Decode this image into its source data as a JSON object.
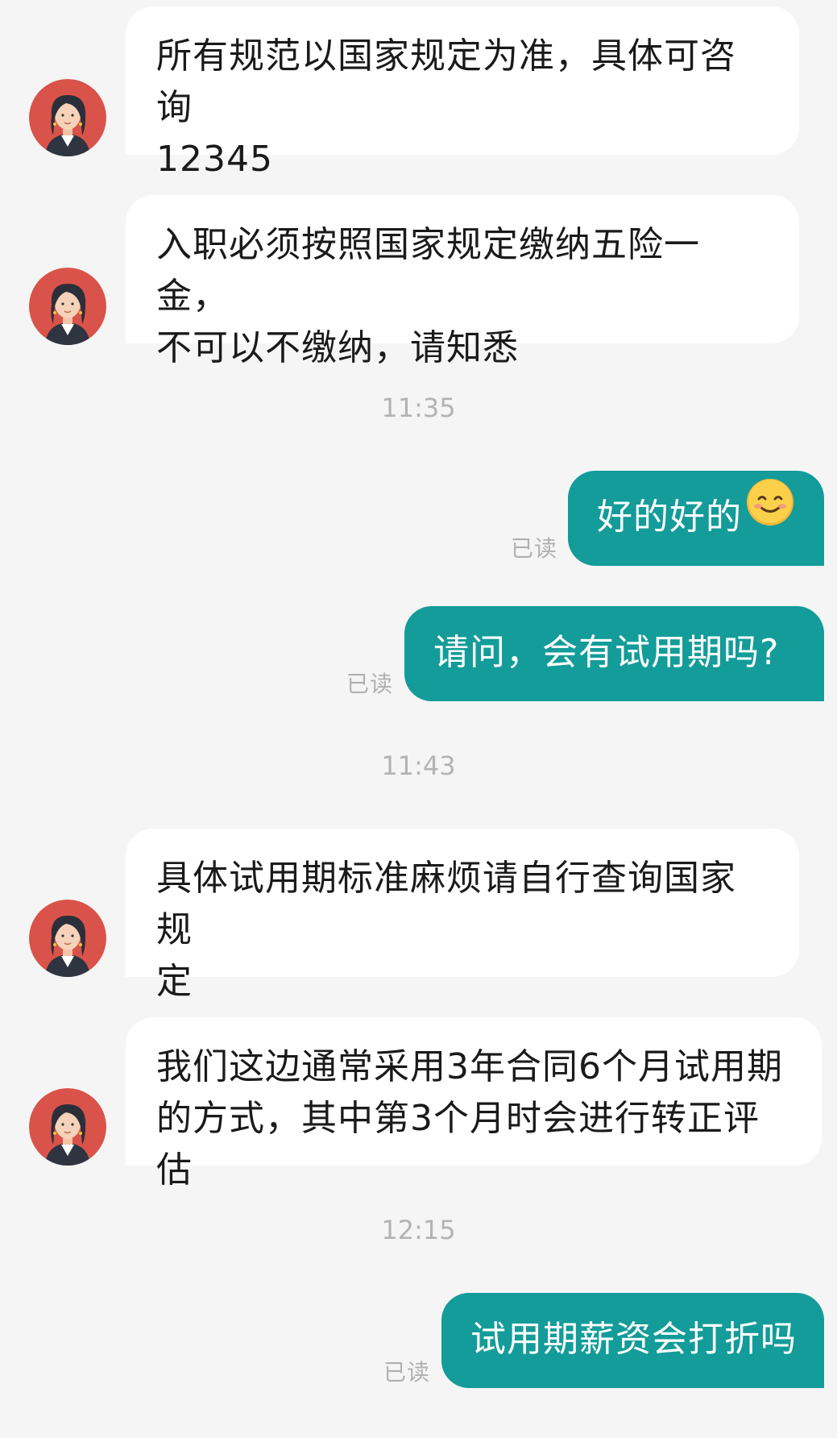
{
  "conversation": {
    "messages": [
      {
        "from": "other",
        "text": "所有规范以国家规定为准，具体可咨询12345",
        "line1": "所有规范以国家规定为准，具体可咨询",
        "line2": "12345"
      },
      {
        "from": "other",
        "text": "入职必须按照国家规定缴纳五险一金，不可以不缴纳，请知悉",
        "line1": "入职必须按照国家规定缴纳五险一金，",
        "line2": "不可以不缴纳，请知悉"
      },
      {
        "type": "timestamp",
        "text": "11:35"
      },
      {
        "from": "me",
        "text": "好的好的",
        "emoji": "smile",
        "status": "已读"
      },
      {
        "from": "me",
        "text": "请问，会有试用期吗?",
        "status": "已读"
      },
      {
        "type": "timestamp",
        "text": "11:43"
      },
      {
        "from": "other",
        "text": "具体试用期标准麻烦请自行查询国家规定",
        "line1": "具体试用期标准麻烦请自行查询国家规",
        "line2": "定"
      },
      {
        "from": "other",
        "text": "我们这边通常采用3年合同6个月试用期的方式，其中第3个月时会进行转正评估",
        "line1": "我们这边通常采用3年合同6个月试用期",
        "line2": "的方式，其中第3个月时会进行转正评估"
      },
      {
        "type": "timestamp",
        "text": "12:15"
      },
      {
        "from": "me",
        "text": "试用期薪资会打折吗",
        "status": "已读"
      }
    ]
  },
  "colors": {
    "background": "#f5f5f5",
    "incoming_bubble": "#ffffff",
    "outgoing_bubble": "#139c99",
    "read_status": "#b0b0b0",
    "timestamp": "#b3b3b3"
  }
}
